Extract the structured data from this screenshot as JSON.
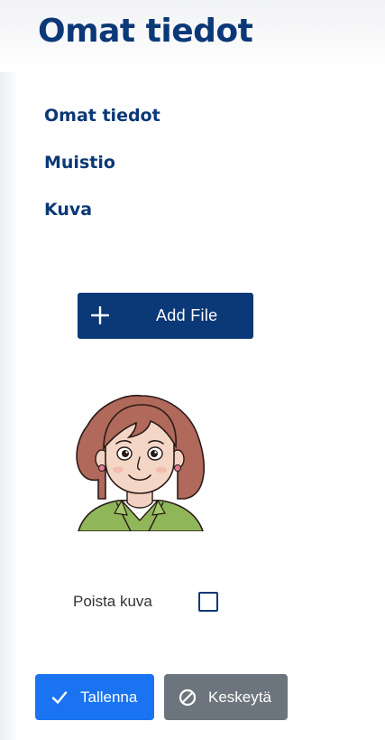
{
  "page": {
    "title": "Omat tiedot"
  },
  "nav": {
    "items": [
      {
        "label": "Omat tiedot"
      },
      {
        "label": "Muistio"
      },
      {
        "label": "Kuva"
      }
    ]
  },
  "upload": {
    "add_file_label": "Add File",
    "icon": "plus-icon"
  },
  "profile_image": {
    "icon": "avatar-woman-illustration"
  },
  "delete_image": {
    "label": "Poista kuva",
    "checked": false
  },
  "actions": {
    "save_label": "Tallenna",
    "save_icon": "check-icon",
    "cancel_label": "Keskeytä",
    "cancel_icon": "ban-icon"
  },
  "colors": {
    "brand_navy": "#0b3877",
    "primary_blue": "#1a73f0",
    "secondary_gray": "#6c757d"
  }
}
